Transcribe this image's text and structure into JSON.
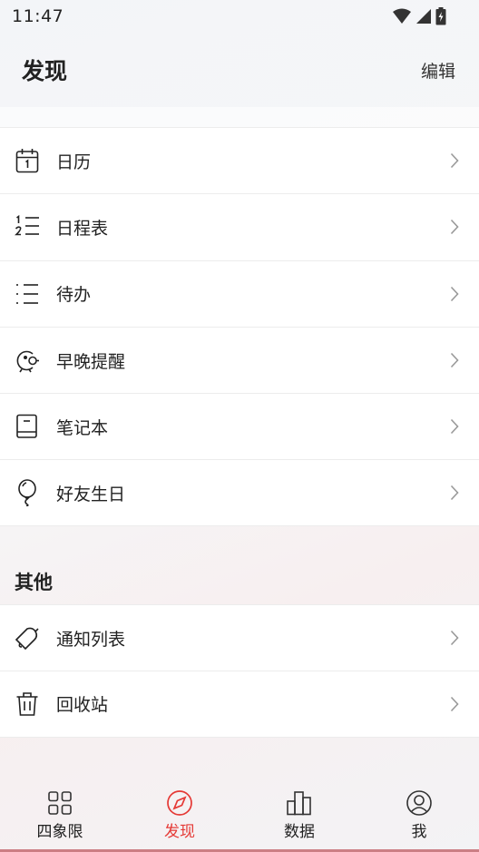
{
  "status_bar": {
    "time": "11:47"
  },
  "header": {
    "title": "发现",
    "edit_label": "编辑"
  },
  "list1": [
    {
      "label": "日历",
      "icon": "calendar-icon"
    },
    {
      "label": "日程表",
      "icon": "numbered-list-icon"
    },
    {
      "label": "待办",
      "icon": "todo-list-icon"
    },
    {
      "label": "早晚提醒",
      "icon": "alarm-bell-icon"
    },
    {
      "label": "笔记本",
      "icon": "notebook-icon"
    },
    {
      "label": "好友生日",
      "icon": "balloon-icon"
    }
  ],
  "other_section": {
    "title": "其他"
  },
  "list2": [
    {
      "label": "通知列表",
      "icon": "notification-bell-icon"
    },
    {
      "label": "回收站",
      "icon": "trash-icon"
    }
  ],
  "tabs": [
    {
      "label": "四象限",
      "icon": "grid-icon"
    },
    {
      "label": "发现",
      "icon": "compass-icon",
      "active": true
    },
    {
      "label": "数据",
      "icon": "bar-chart-icon"
    },
    {
      "label": "我",
      "icon": "profile-icon"
    }
  ],
  "colors": {
    "accent": "#e53935",
    "text": "#222222",
    "divider": "#ececec"
  }
}
